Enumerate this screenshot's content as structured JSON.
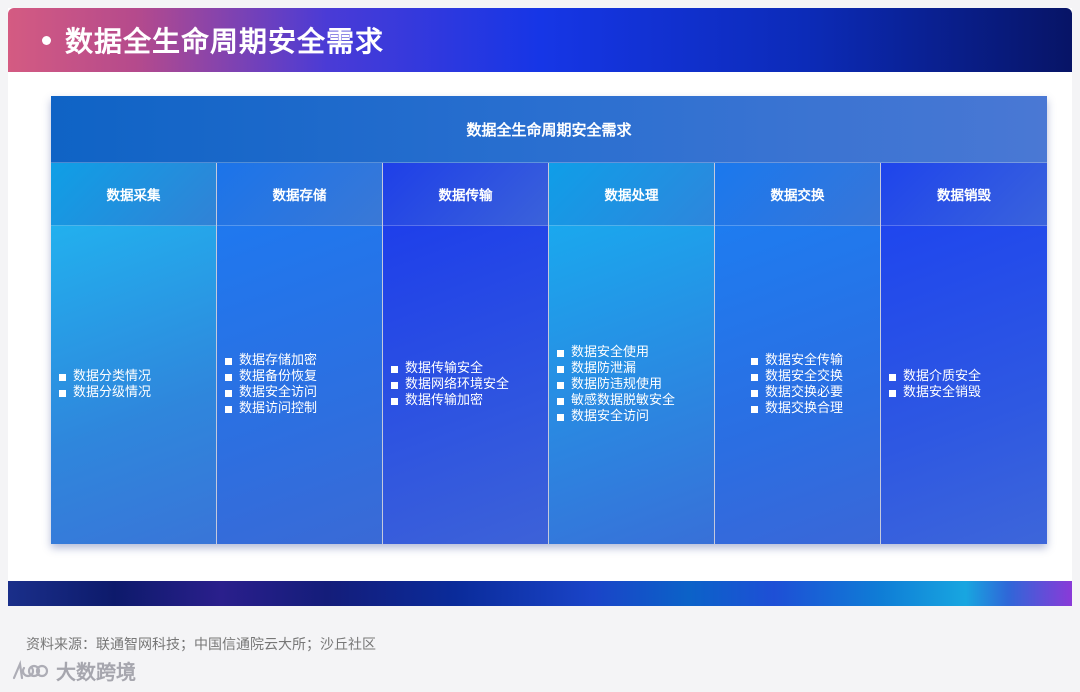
{
  "slide": {
    "title": "数据全生命周期安全需求"
  },
  "table": {
    "header": "数据全生命周期安全需求",
    "stages": [
      {
        "title": "数据采集",
        "items": [
          "数据分类情况",
          "数据分级情况"
        ]
      },
      {
        "title": "数据存储",
        "items": [
          "数据存储加密",
          "数据备份恢复",
          "数据安全访问",
          "数据访问控制"
        ]
      },
      {
        "title": "数据传输",
        "items": [
          "数据传输安全",
          "数据网络环境安全",
          "数据传输加密"
        ]
      },
      {
        "title": "数据处理",
        "items": [
          "数据安全使用",
          "数据防泄漏",
          "数据防违规使用",
          "敏感数据脱敏安全",
          "数据安全访问"
        ]
      },
      {
        "title": "数据交换",
        "items": [
          "数据安全传输",
          "数据安全交换",
          "数据交换必要",
          "数据交换合理"
        ]
      },
      {
        "title": "数据销毁",
        "items": [
          "数据介质安全",
          "数据安全销毁"
        ]
      }
    ]
  },
  "footer": {
    "source": "资料来源：联通智网科技；中国信通院云大所；沙丘社区",
    "watermark": "大数跨境"
  },
  "colors": {
    "title_bar_start": "#d45b82",
    "title_bar_end": "#071466",
    "accent_blue": "#1e3fe8",
    "accent_cyan": "#22b0ee"
  }
}
